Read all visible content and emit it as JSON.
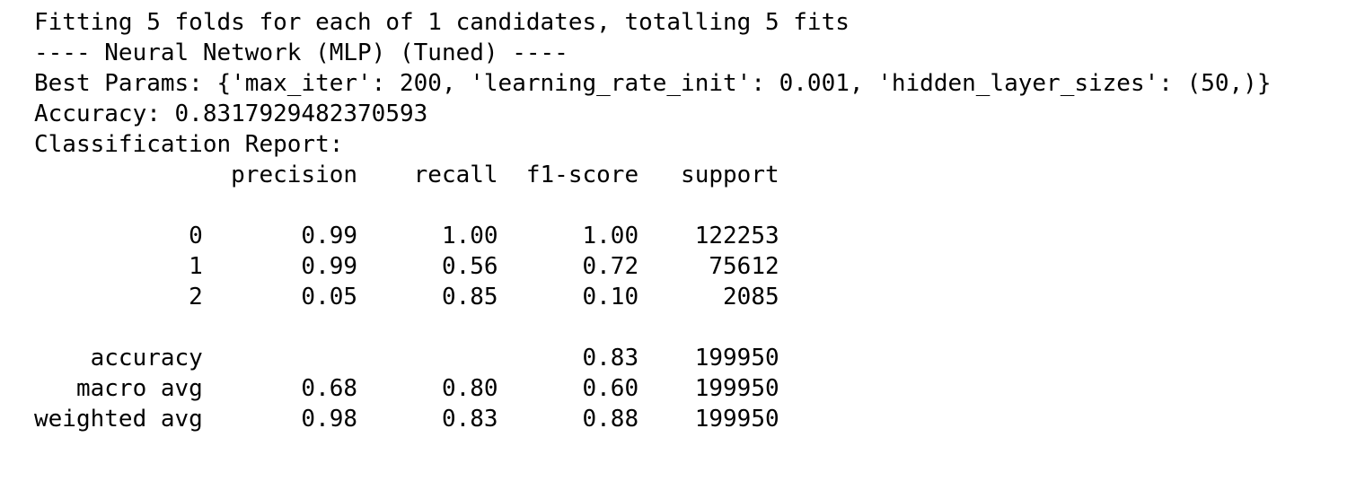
{
  "output_lines": [
    "Fitting 5 folds for each of 1 candidates, totalling 5 fits",
    "---- Neural Network (MLP) (Tuned) ----",
    "Best Params: {'max_iter': 200, 'learning_rate_init': 0.001, 'hidden_layer_sizes': (50,)}",
    "Accuracy: 0.8317929482370593",
    "Classification Report:",
    "              precision    recall  f1-score   support",
    "",
    "           0       0.99      1.00      1.00    122253",
    "           1       0.99      0.56      0.72     75612",
    "           2       0.05      0.85      0.10      2085",
    "",
    "    accuracy                           0.83    199950",
    "   macro avg       0.68      0.80      0.60    199950",
    "weighted avg       0.98      0.83      0.88    199950"
  ]
}
